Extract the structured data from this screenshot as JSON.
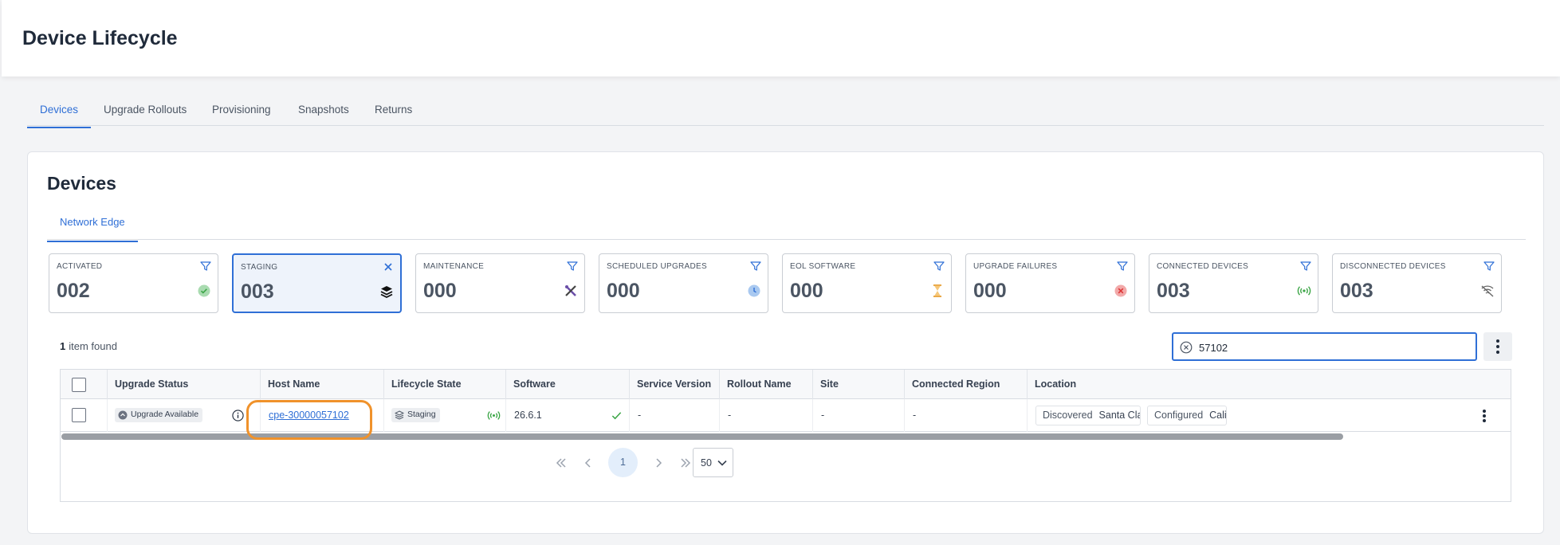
{
  "header": {
    "title": "Device Lifecycle"
  },
  "tabs": [
    {
      "label": "Devices",
      "active": true
    },
    {
      "label": "Upgrade Rollouts"
    },
    {
      "label": "Provisioning"
    },
    {
      "label": "Snapshots"
    },
    {
      "label": "Returns"
    }
  ],
  "card": {
    "title": "Devices",
    "subtab": "Network Edge"
  },
  "stats": [
    {
      "label": "ACTIVATED",
      "value": "002",
      "icon": "check-circle-icon"
    },
    {
      "label": "STAGING",
      "value": "003",
      "icon": "layers-icon",
      "selected": true
    },
    {
      "label": "MAINTENANCE",
      "value": "000",
      "icon": "tools-icon"
    },
    {
      "label": "SCHEDULED UPGRADES",
      "value": "000",
      "icon": "clock-icon"
    },
    {
      "label": "EOL SOFTWARE",
      "value": "000",
      "icon": "hourglass-icon"
    },
    {
      "label": "UPGRADE FAILURES",
      "value": "000",
      "icon": "error-circle-icon"
    },
    {
      "label": "CONNECTED DEVICES",
      "value": "003",
      "icon": "signal-icon"
    },
    {
      "label": "DISCONNECTED DEVICES",
      "value": "003",
      "icon": "no-signal-icon"
    }
  ],
  "results": {
    "count": "1",
    "label": "item found"
  },
  "search": {
    "value": "57102"
  },
  "table": {
    "columns": [
      "Upgrade Status",
      "Host Name",
      "Lifecycle State",
      "Software",
      "Service Version",
      "Rollout Name",
      "Site",
      "Connected Region",
      "Location"
    ],
    "row": {
      "upgrade_status": "Upgrade Available",
      "host_name": "cpe-30000057102",
      "lifecycle_state": "Staging",
      "software": "26.6.1",
      "service_version": "-",
      "rollout_name": "-",
      "site": "-",
      "connected_region": "-",
      "location_discovered_key": "Discovered",
      "location_discovered_val": "Santa Clara",
      "location_configured_key": "Configured",
      "location_configured_val": "Califor"
    }
  },
  "pagination": {
    "current_page": "1",
    "page_size": "50"
  },
  "colors": {
    "accent": "#2f6fd6",
    "highlight": "#f0922b",
    "success": "#3aa545"
  }
}
